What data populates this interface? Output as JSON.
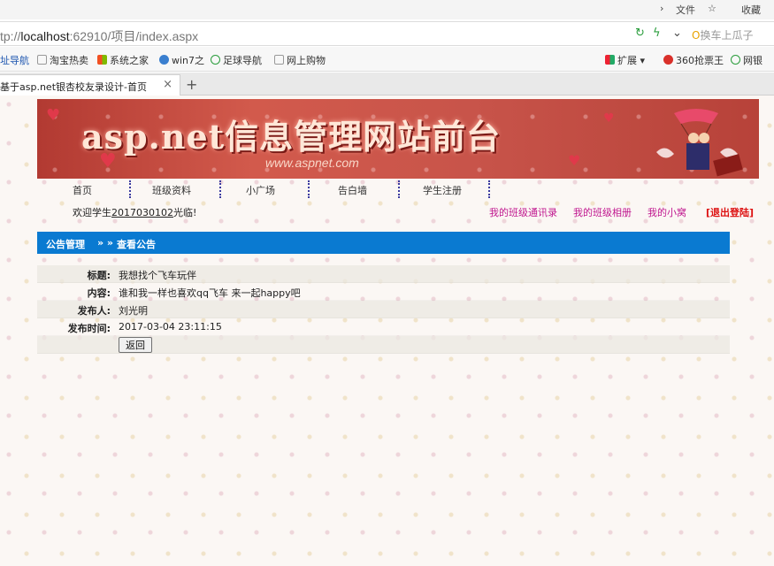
{
  "browser": {
    "menu": [
      "文件",
      "收藏"
    ],
    "address": {
      "prefix": "tp://",
      "host": "localhost",
      "rest": ":62910/项目/index.aspx"
    },
    "search_placeholder": "换车上瓜子",
    "bookmarks": [
      "址导航",
      "淘宝热卖",
      "系统之家",
      "win7之",
      "足球导航",
      "网上购物",
      "扩展",
      "360抢票王",
      "网银"
    ],
    "tab_title": "基于asp.net银杏校友录设计-首页",
    "tab_close": "×",
    "new_tab": "+"
  },
  "banner": {
    "title": "asp.net信息管理网站前台",
    "subtitle": "www.aspnet.com"
  },
  "nav": {
    "items": [
      "首页",
      "班级资料",
      "小广场",
      "告白墙",
      "学生注册"
    ]
  },
  "welcome": {
    "prefix": "欢迎学生",
    "user_id": "2017030102",
    "suffix": "光临!"
  },
  "quick_links": [
    "我的班级通讯录",
    "我的班级相册",
    "我的小窝"
  ],
  "logout_label": "[退出登陆]",
  "section": {
    "parent": "公告管理",
    "separator": "»  »",
    "current": "查看公告"
  },
  "notice": {
    "title_label": "标题:",
    "title_value": "我想找个飞车玩伴",
    "content_label": "内容:",
    "content_value": "谁和我一样也喜欢qq飞车 来一起happy吧",
    "author_label": "发布人:",
    "author_value": "刘光明",
    "time_label": "发布时间:",
    "time_value": "2017-03-04 23:11:15",
    "back_label": "返回"
  },
  "colors": {
    "section_bar": "#0a7ad1",
    "quick_link": "#c0178f",
    "logout": "#dd1111"
  }
}
